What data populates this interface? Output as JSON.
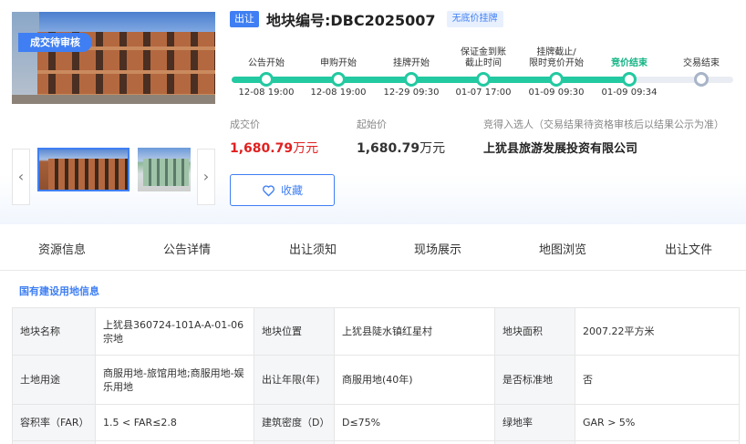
{
  "gallery": {
    "status_tag": "成交待审核",
    "prev_icon": "‹",
    "next_icon": "›"
  },
  "header": {
    "badge_type": "出让",
    "title": "地块编号:DBC2025007",
    "badge_floor": "无底价挂牌"
  },
  "timeline": {
    "steps": [
      {
        "label": "公告开始",
        "time": "12-08 19:00",
        "state": "done"
      },
      {
        "label": "申购开始",
        "time": "12-08 19:00",
        "state": "done"
      },
      {
        "label": "挂牌开始",
        "time": "12-29 09:30",
        "state": "done"
      },
      {
        "label": "保证金到账截止时间",
        "time": "01-07 17:00",
        "state": "done"
      },
      {
        "label": "挂牌截止/限时竞价开始",
        "time": "01-09 09:30",
        "state": "done"
      },
      {
        "label": "竞价结束",
        "time": "01-09 09:34",
        "state": "active"
      },
      {
        "label": "交易结束",
        "time": "",
        "state": "pending"
      }
    ],
    "progress": 0.79,
    "colors": {
      "done": "#23c9a1",
      "pending": "#a8b4c8"
    }
  },
  "prices": {
    "deal_label": "成交价",
    "deal_value": "1,680.79",
    "deal_unit": "万元",
    "start_label": "起始价",
    "start_value": "1,680.79",
    "start_unit": "万元",
    "winner_label": "竞得入选人（交易结果待资格审核后以结果公示为准）",
    "winner_value": "上犹县旅游发展投资有限公司"
  },
  "favorite": {
    "label": "收藏",
    "icon": "heart-outline-icon"
  },
  "tabs": [
    {
      "label": "资源信息",
      "active": true
    },
    {
      "label": "公告详情",
      "active": false
    },
    {
      "label": "出让须知",
      "active": false
    },
    {
      "label": "现场展示",
      "active": false
    },
    {
      "label": "地图浏览",
      "active": false
    },
    {
      "label": "出让文件",
      "active": false
    }
  ],
  "section": {
    "title": "国有建设用地信息"
  },
  "info_table": {
    "rows": [
      [
        {
          "k": "地块名称",
          "v": "上犹县360724-101A-A-01-06宗地"
        },
        {
          "k": "地块位置",
          "v": "上犹县陡水镇红星村"
        },
        {
          "k": "地块面积",
          "v": "2007.22平方米"
        }
      ],
      [
        {
          "k": "土地用途",
          "v": "商服用地-旅馆用地;商服用地-娱乐用地"
        },
        {
          "k": "出让年限(年)",
          "v": "商服用地(40年)"
        },
        {
          "k": "是否标准地",
          "v": "否"
        }
      ],
      [
        {
          "k": "容积率（FAR）",
          "v": "1.5 < FAR≤2.8"
        },
        {
          "k": "建筑密度（D）",
          "v": "D≤75%"
        },
        {
          "k": "绿地率",
          "v": "GAR > 5%"
        }
      ]
    ]
  },
  "colors": {
    "accent": "#3f7ff3",
    "price_red": "#e02020",
    "success": "#23c9a1"
  }
}
